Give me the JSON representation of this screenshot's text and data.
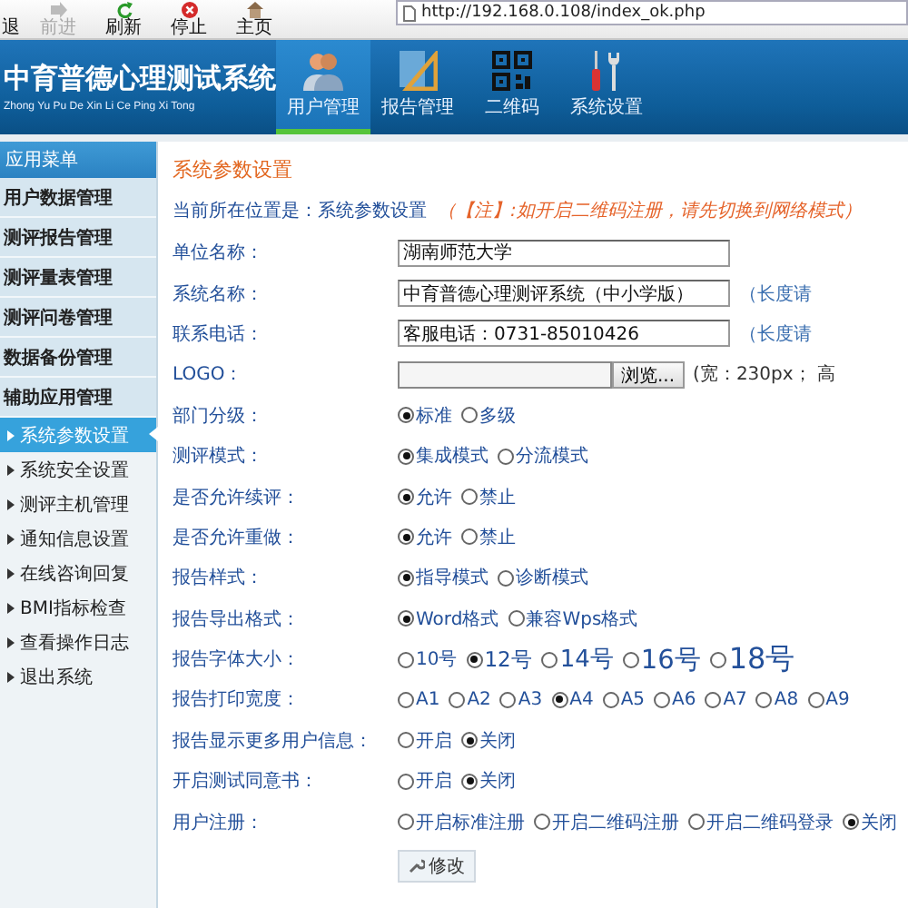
{
  "browser": {
    "buttons": [
      {
        "label": "退",
        "disabled": false
      },
      {
        "label": "前进",
        "kind": "forward",
        "disabled": true
      },
      {
        "label": "刷新",
        "kind": "refresh",
        "disabled": false
      },
      {
        "label": "停止",
        "kind": "stop",
        "disabled": false
      },
      {
        "label": "主页",
        "kind": "home",
        "disabled": false
      }
    ],
    "address": "http://192.168.0.108/index_ok.php"
  },
  "header": {
    "title": "中育普德心理测试系统",
    "subtitle": "Zhong Yu Pu De Xin Li Ce Ping Xi Tong",
    "nav": [
      {
        "label": "用户管理",
        "kind": "users",
        "selected": true
      },
      {
        "label": "报告管理",
        "kind": "ruler",
        "selected": false
      },
      {
        "label": "二维码",
        "kind": "qr",
        "selected": false
      },
      {
        "label": "系统设置",
        "kind": "tools",
        "selected": false
      }
    ]
  },
  "sidebar": {
    "title": "应用菜单",
    "groups": [
      "用户数据管理",
      "测评报告管理",
      "测评量表管理",
      "测评问卷管理",
      "数据备份管理",
      "辅助应用管理"
    ],
    "items": [
      {
        "label": "系统参数设置",
        "selected": true
      },
      {
        "label": "系统安全设置",
        "selected": false
      },
      {
        "label": "测评主机管理",
        "selected": false
      },
      {
        "label": "通知信息设置",
        "selected": false
      },
      {
        "label": "在线咨询回复",
        "selected": false
      },
      {
        "label": "BMI指标检查",
        "selected": false
      },
      {
        "label": "查看操作日志",
        "selected": false
      },
      {
        "label": "退出系统",
        "selected": false
      }
    ]
  },
  "content": {
    "title": "系统参数设置",
    "breadcrumb": "当前所在位置是：系统参数设置",
    "notice": "（【注】:如开启二维码注册，请先切换到网络模式）",
    "fields": [
      {
        "kind": "text",
        "label": "单位名称：",
        "value": "湖南师范大学"
      },
      {
        "kind": "text",
        "label": "系统名称：",
        "value": "中育普德心理测评系统（中小学版）",
        "hint": "（长度请"
      },
      {
        "kind": "text",
        "label": "联系电话：",
        "value": "客服电话：0731-85010426",
        "hint": "（长度请"
      },
      {
        "kind": "file",
        "label": "LOGO：",
        "button": "浏览...",
        "hint": "(宽：230px； 高"
      },
      {
        "kind": "radio",
        "label": "部门分级：",
        "options": [
          {
            "label": "标准",
            "selected": true
          },
          {
            "label": "多级",
            "selected": false
          }
        ]
      },
      {
        "kind": "radio",
        "label": "测评模式：",
        "options": [
          {
            "label": "集成模式",
            "selected": true
          },
          {
            "label": "分流模式",
            "selected": false
          }
        ]
      },
      {
        "kind": "radio",
        "label": "是否允许续评：",
        "options": [
          {
            "label": "允许",
            "selected": true
          },
          {
            "label": "禁止",
            "selected": false
          }
        ]
      },
      {
        "kind": "radio",
        "label": "是否允许重做：",
        "options": [
          {
            "label": "允许",
            "selected": true
          },
          {
            "label": "禁止",
            "selected": false
          }
        ]
      },
      {
        "kind": "radio",
        "label": "报告样式：",
        "options": [
          {
            "label": "指导模式",
            "selected": true
          },
          {
            "label": "诊断模式",
            "selected": false
          }
        ]
      },
      {
        "kind": "radio",
        "label": "报告导出格式：",
        "options": [
          {
            "label": "Word格式",
            "selected": true
          },
          {
            "label": "兼容Wps格式",
            "selected": false
          }
        ]
      },
      {
        "kind": "sizes",
        "label": "报告字体大小：",
        "options": [
          {
            "label": "10号",
            "selected": false
          },
          {
            "label": "12号",
            "selected": true
          },
          {
            "label": "14号",
            "selected": false
          },
          {
            "label": "16号",
            "selected": false
          },
          {
            "label": "18号",
            "selected": false
          }
        ]
      },
      {
        "kind": "radio",
        "label": "报告打印宽度：",
        "options": [
          {
            "label": "A1",
            "selected": false
          },
          {
            "label": "A2",
            "selected": false
          },
          {
            "label": "A3",
            "selected": false
          },
          {
            "label": "A4",
            "selected": true
          },
          {
            "label": "A5",
            "selected": false
          },
          {
            "label": "A6",
            "selected": false
          },
          {
            "label": "A7",
            "selected": false
          },
          {
            "label": "A8",
            "selected": false
          },
          {
            "label": "A9",
            "selected": false
          }
        ]
      },
      {
        "kind": "radio",
        "label": "报告显示更多用户信息：",
        "options": [
          {
            "label": "开启",
            "selected": false
          },
          {
            "label": "关闭",
            "selected": true
          }
        ]
      },
      {
        "kind": "radio",
        "label": "开启测试同意书：",
        "options": [
          {
            "label": "开启",
            "selected": false
          },
          {
            "label": "关闭",
            "selected": true
          }
        ]
      },
      {
        "kind": "radio",
        "label": "用户注册：",
        "options": [
          {
            "label": "开启标准注册",
            "selected": false
          },
          {
            "label": "开启二维码注册",
            "selected": false
          },
          {
            "label": "开启二维码登录",
            "selected": false
          },
          {
            "label": "关闭",
            "selected": true
          }
        ]
      }
    ],
    "submit": "修改"
  }
}
